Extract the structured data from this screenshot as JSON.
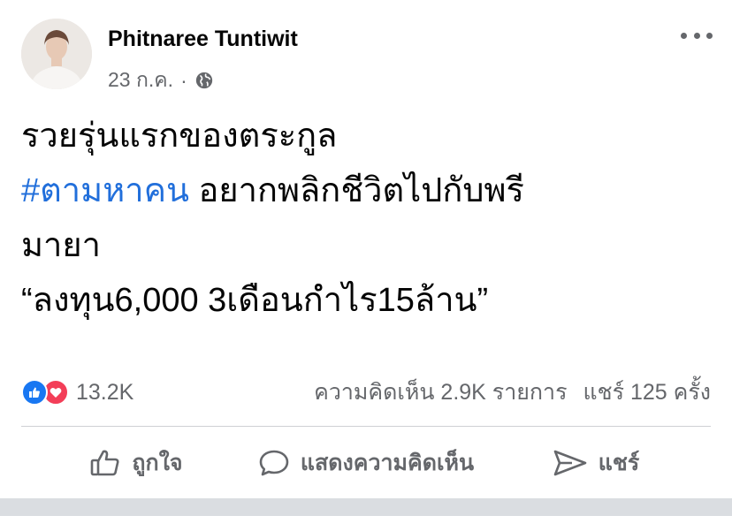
{
  "post": {
    "author": "Phitnaree Tuntiwit",
    "date": "23 ก.ค.",
    "separator": "·",
    "privacy_icon": "globe-icon",
    "more_icon": "more-horizontal-icon",
    "body": {
      "line1": "รวยรุ่นแรกของตระกูล",
      "hashtag": "#ตามหาคน",
      "line2_rest": " อยากพลิกชีวิตไปกับพรี",
      "line3": "มายา",
      "line4": "“ลงทุน6,000 3เดือนกำไร15ล้าน”"
    }
  },
  "stats": {
    "reaction_icons": [
      "like-icon",
      "love-icon"
    ],
    "reaction_count": "13.2K",
    "comments": "ความคิดเห็น 2.9K รายการ",
    "shares": "แชร์ 125 ครั้ง"
  },
  "actions": {
    "like_label": "ถูกใจ",
    "comment_label": "แสดงความคิดเห็น",
    "share_label": "แชร์"
  },
  "colors": {
    "hashtag": "#216fdb",
    "like_blue": "#1877f2",
    "love_red": "#f33e58",
    "secondary_text": "#65676b"
  }
}
